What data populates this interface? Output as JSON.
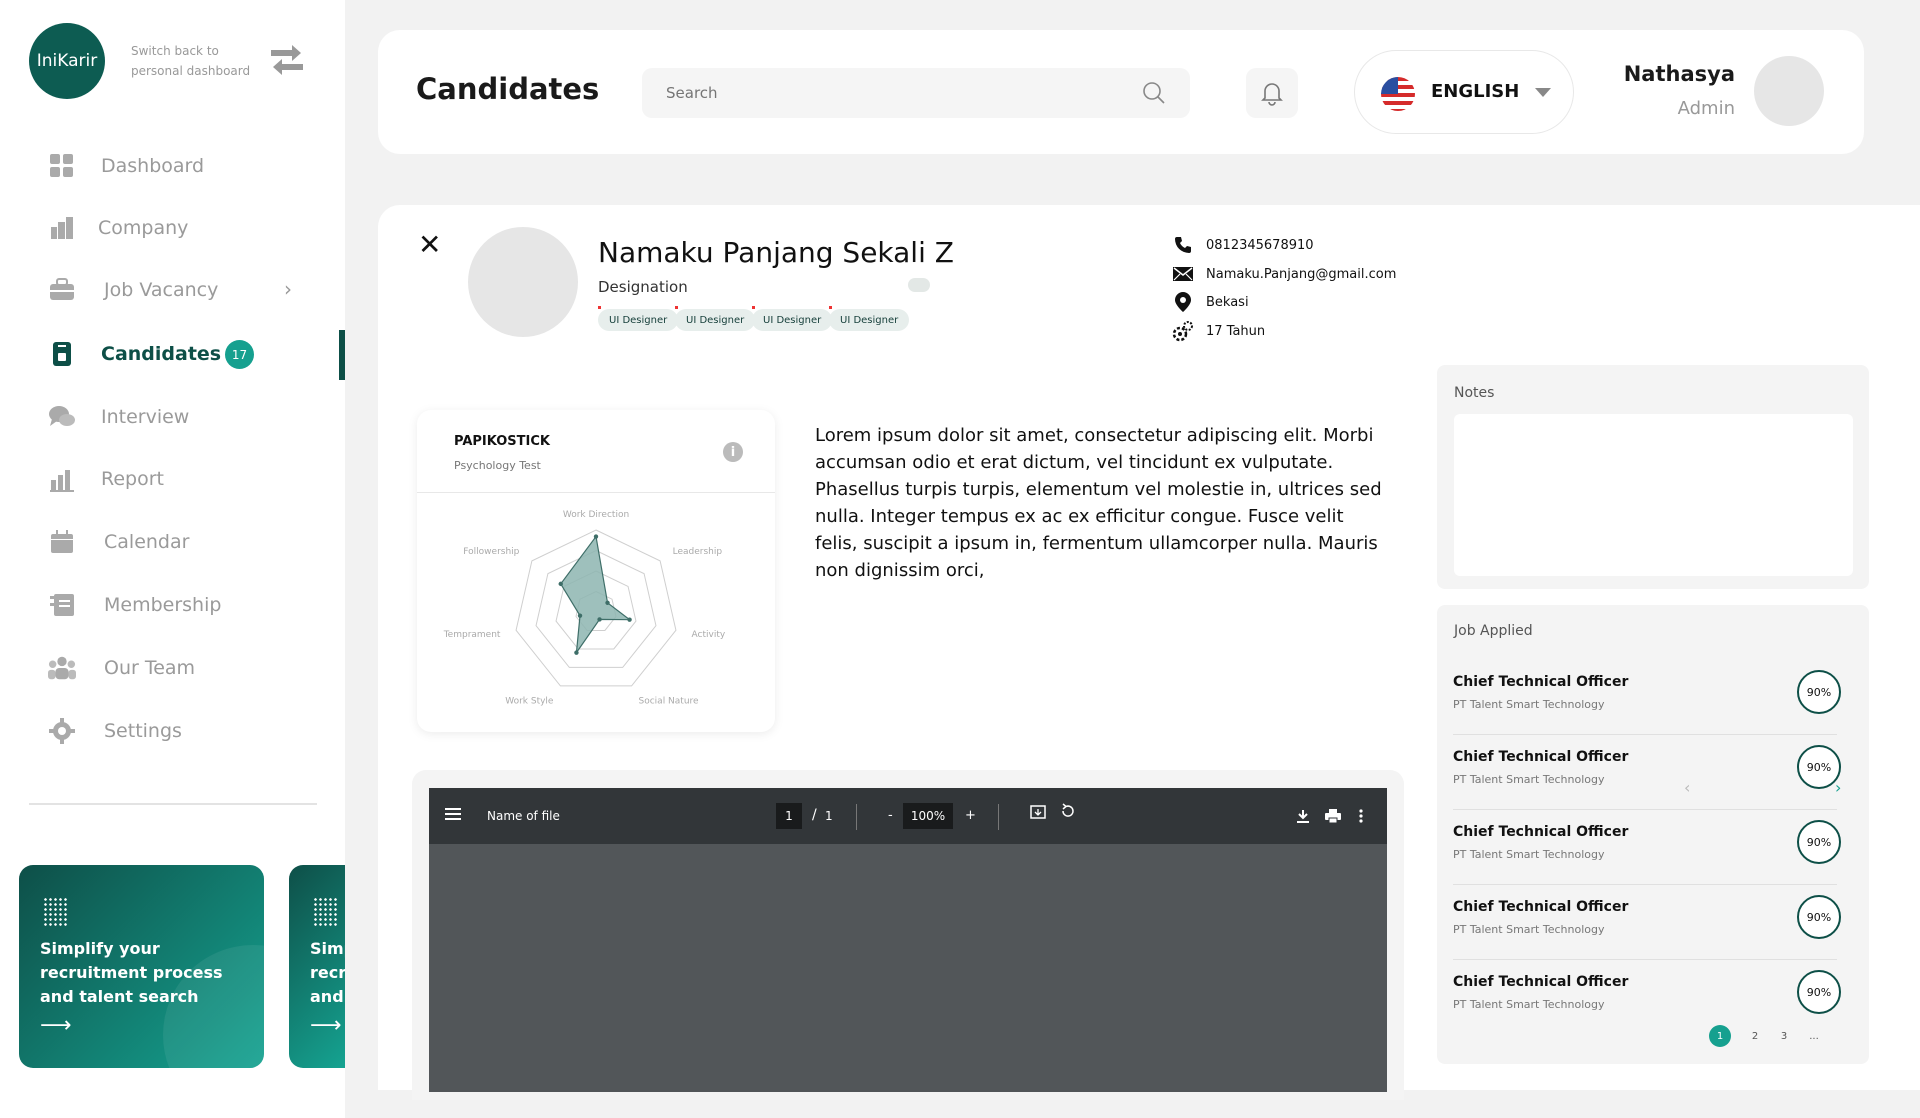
{
  "brand": {
    "logo_text": "IniKarir",
    "switch_text_1": "Switch back to",
    "switch_text_2": "personal dashboard"
  },
  "sidebar": {
    "items": [
      {
        "label": "Dashboard"
      },
      {
        "label": "Company"
      },
      {
        "label": "Job Vacancy"
      },
      {
        "label": "Candidates",
        "badge": "17"
      },
      {
        "label": "Interview"
      },
      {
        "label": "Report"
      },
      {
        "label": "Calendar"
      },
      {
        "label": "Membership"
      },
      {
        "label": "Our Team"
      },
      {
        "label": "Settings"
      }
    ],
    "promo": {
      "line1": "Simplify your",
      "line2": "recruitment process",
      "line3": "and talent search",
      "arrow": "⟶"
    }
  },
  "header": {
    "title": "Candidates",
    "search_placeholder": "Search",
    "language": "ENGLISH",
    "user_name": "Nathasya",
    "user_role": "Admin"
  },
  "candidate": {
    "name": "Namaku Panjang Sekali Z",
    "designation": "Designation",
    "tags": [
      "UI Designer",
      "UI Designer",
      "UI Designer",
      "UI Designer"
    ],
    "phone": "0812345678910",
    "email": "Namaku.Panjang@gmail.com",
    "location": "Bekasi",
    "age": "17 Tahun",
    "bio": "Lorem ipsum dolor sit amet, consectetur adipiscing elit. Morbi accumsan odio et erat dictum, vel tincidunt ex vulputate. Phasellus turpis turpis, elementum vel molestie in, ultrices sed nulla. Integer tempus ex ac ex efficitur congue. Fusce velit felis, suscipit a ipsum in, fermentum ullamcorper nulla. Mauris non dignissim orci,"
  },
  "papikostick": {
    "title": "PAPIKOSTICK",
    "subtitle": "Psychology Test",
    "info_glyph": "i",
    "chart_data": {
      "type": "radar",
      "categories": [
        "Work Direction",
        "Leadership",
        "Activity",
        "Social Nature",
        "Work Style",
        "Temprament",
        "Followership"
      ],
      "values": [
        0.92,
        0.18,
        0.42,
        0.1,
        0.55,
        0.2,
        0.55
      ],
      "rings": 4,
      "fill_color": "#8db5b0",
      "line_color": "#3e6e68"
    }
  },
  "pdf": {
    "file_name": "Name of file",
    "page_current": "1",
    "page_sep": "/",
    "page_total": "1",
    "zoom": "100%",
    "zoom_out": "-",
    "zoom_in": "+"
  },
  "notes": {
    "label": "Notes"
  },
  "jobs": {
    "label": "Job Applied",
    "items": [
      {
        "title": "Chief Technical Officer",
        "company": "PT Talent Smart Technology",
        "match": "90%"
      },
      {
        "title": "Chief Technical Officer",
        "company": "PT Talent Smart Technology",
        "match": "90%"
      },
      {
        "title": "Chief Technical Officer",
        "company": "PT Talent Smart Technology",
        "match": "90%"
      },
      {
        "title": "Chief Technical Officer",
        "company": "PT Talent Smart Technology",
        "match": "90%"
      },
      {
        "title": "Chief Technical Officer",
        "company": "PT Talent Smart Technology",
        "match": "90%"
      }
    ],
    "pages": [
      "1",
      "2",
      "3",
      "..."
    ],
    "prev_glyph": "‹",
    "next_glyph": "›"
  },
  "colors": {
    "primary": "#0d4f47",
    "accent": "#16a08f"
  }
}
